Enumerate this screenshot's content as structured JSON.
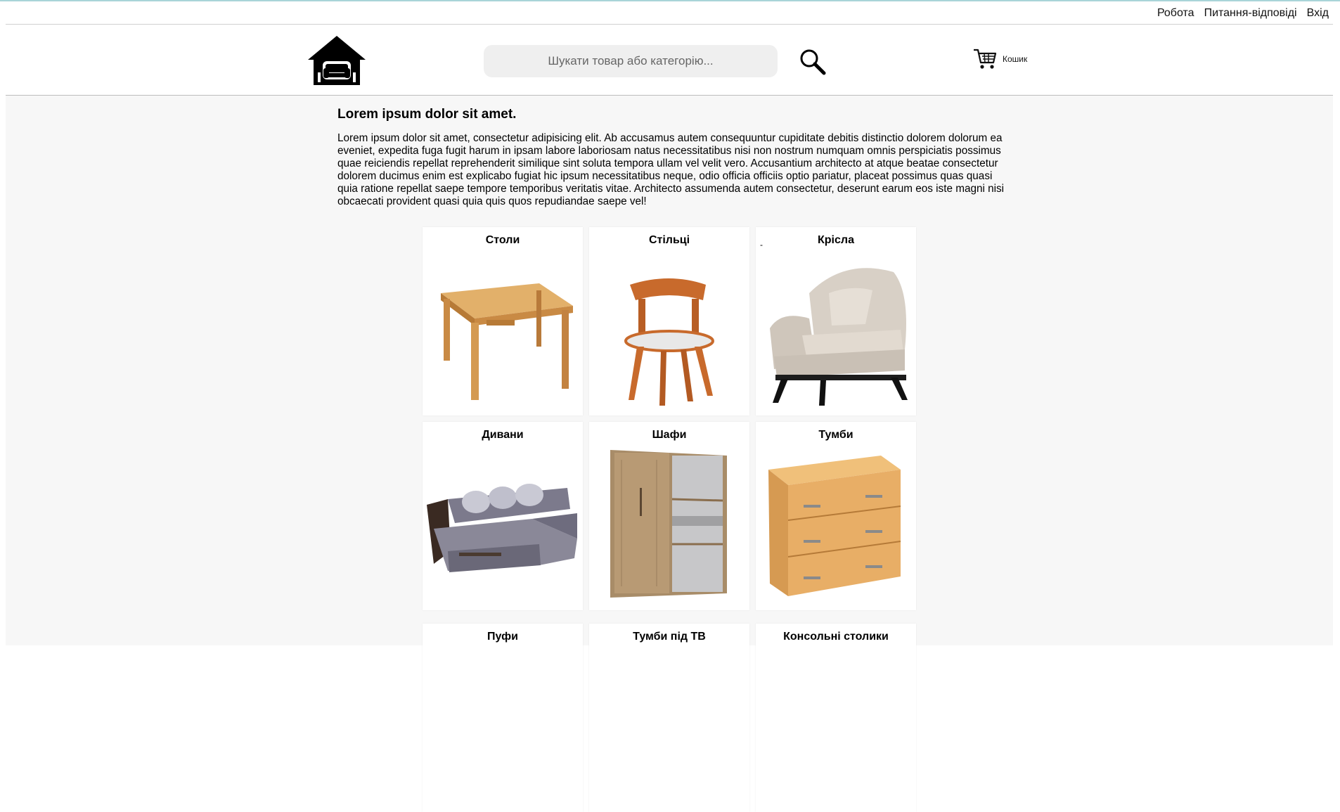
{
  "topnav": {
    "links": [
      "Робота",
      "Питання-відповіді",
      "Вхід"
    ]
  },
  "header": {
    "search_placeholder": "Шукати товар або категорію...",
    "cart_label": "Кошик"
  },
  "intro": {
    "title": "Lorem ipsum dolor sit amet.",
    "text": "Lorem ipsum dolor sit amet, consectetur adipisicing elit. Ab accusamus autem consequuntur cupiditate debitis distinctio dolorem dolorum ea eveniet, expedita fuga fugit harum in ipsam labore laboriosam natus necessitatibus nisi non nostrum numquam omnis perspiciatis possimus quae reiciendis repellat reprehenderit similique sint soluta tempora ullam vel velit vero. Accusantium architecto at atque beatae consectetur dolorem ducimus enim est explicabo fugiat hic ipsum necessitatibus neque, odio officia officiis optio pariatur, placeat possimus quas quasi quia ratione repellat saepe tempore temporibus veritatis vitae. Architecto assumenda autem consectetur, deserunt earum eos iste magni nisi obcaecati provident quasi quia quis quos repudiandae saepe vel!"
  },
  "categories": [
    {
      "title": "Столи",
      "icon": "table-icon"
    },
    {
      "title": "Стільці",
      "icon": "chair-icon"
    },
    {
      "title": "Крісла",
      "icon": "armchair-icon",
      "marker": "-"
    },
    {
      "title": "Дивани",
      "icon": "sofa-icon"
    },
    {
      "title": "Шафи",
      "icon": "wardrobe-icon"
    },
    {
      "title": "Тумби",
      "icon": "dresser-icon"
    },
    {
      "title": "Пуфи",
      "icon": "pouf-icon"
    },
    {
      "title": "Тумби під ТВ",
      "icon": "tv-stand-icon"
    },
    {
      "title": "Консольні столики",
      "icon": "console-table-icon"
    }
  ],
  "colors": {
    "accent_line": "#a9d4d8",
    "main_bg": "#f7f7f7",
    "search_bg": "#efefef",
    "wood": "#d9a35c"
  }
}
